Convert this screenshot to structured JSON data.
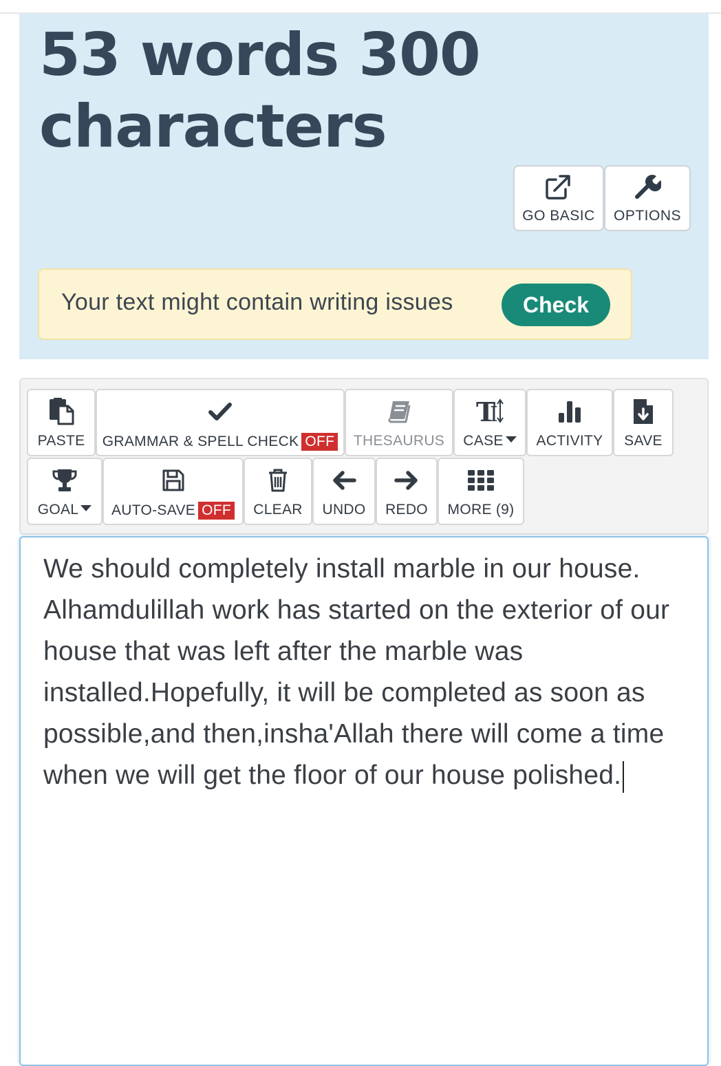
{
  "header": {
    "count_text": "53 words 300 characters",
    "buttons": {
      "go_basic": "GO BASIC",
      "options": "OPTIONS"
    }
  },
  "notice": {
    "text": "Your text might contain writing issues",
    "check_label": "Check"
  },
  "toolbar": {
    "paste": "PASTE",
    "grammar": "GRAMMAR & SPELL CHECK",
    "grammar_state": "OFF",
    "thesaurus": "THESAURUS",
    "case": "CASE",
    "activity": "ACTIVITY",
    "save": "SAVE",
    "goal": "GOAL",
    "autosave": "AUTO-SAVE",
    "autosave_state": "OFF",
    "clear": "CLEAR",
    "undo": "UNDO",
    "redo": "REDO",
    "more": "MORE (9)"
  },
  "editor": {
    "content": "We should completely install marble in our house. Alhamdulillah work has started on the exterior of our house that was left after the marble was installed.Hopefully, it will be completed as soon as possible,and then,insha'Allah there will come a time when we will get the floor of our house polished."
  },
  "colors": {
    "header_bg": "#d9ebf5",
    "title_text": "#37475a",
    "notice_bg": "#fdf4d3",
    "check_button": "#198a78",
    "off_badge": "#d02f2f",
    "editor_border": "#8fc3e3"
  },
  "icons": {
    "go_basic": "external-link-icon",
    "options": "wrench-icon",
    "paste": "paste-icon",
    "grammar": "checkmark-icon",
    "thesaurus": "book-icon",
    "case": "text-case-icon",
    "activity": "bar-chart-icon",
    "save": "file-download-icon",
    "goal": "trophy-icon",
    "autosave": "floppy-disk-icon",
    "clear": "trash-icon",
    "undo": "arrow-left-icon",
    "redo": "arrow-right-icon",
    "more": "grid-icon"
  }
}
